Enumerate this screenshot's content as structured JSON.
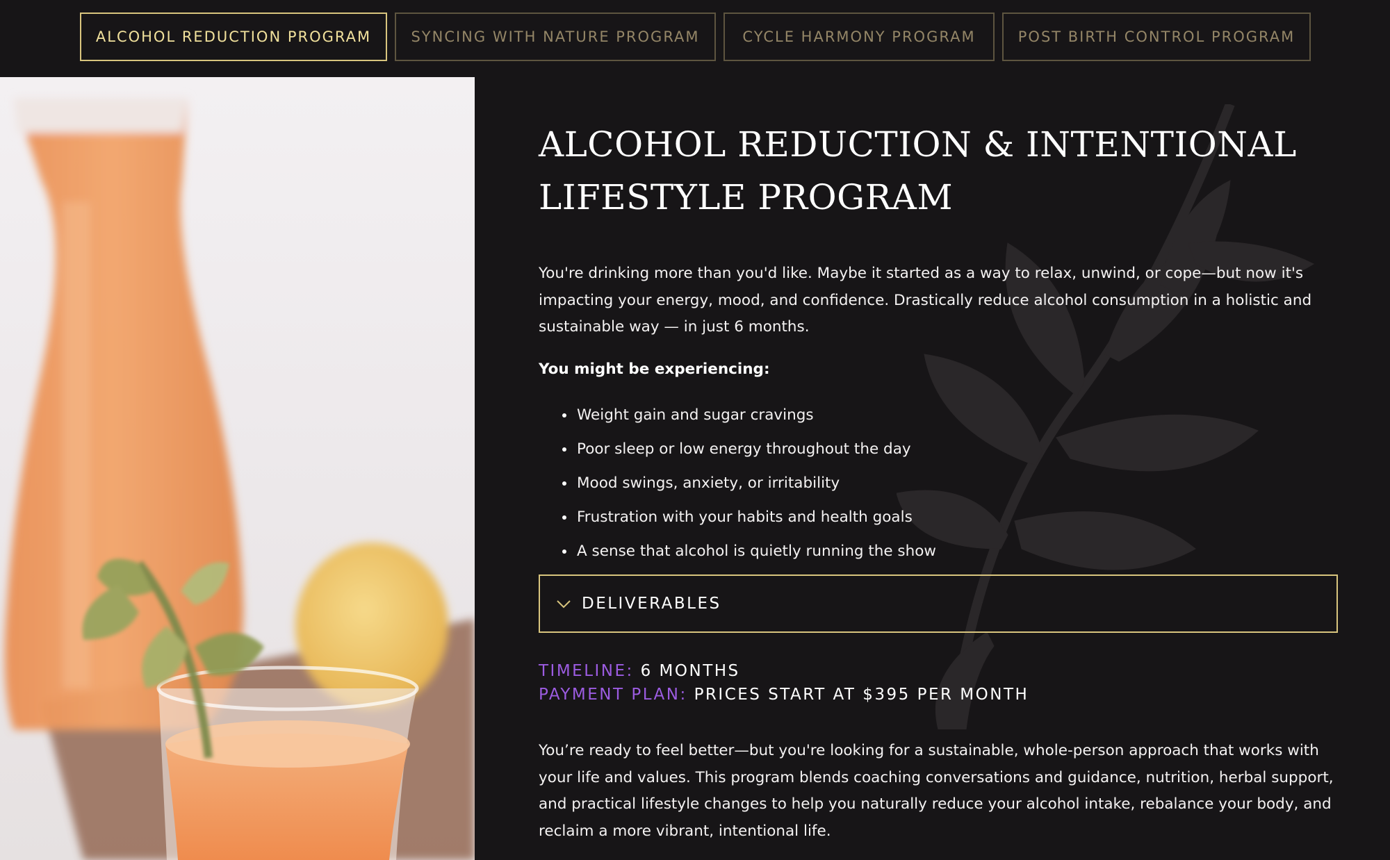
{
  "tabs": [
    {
      "label": "ALCOHOL REDUCTION PROGRAM",
      "active": true
    },
    {
      "label": "SYNCING WITH NATURE PROGRAM",
      "active": false
    },
    {
      "label": "CYCLE HARMONY PROGRAM",
      "active": false
    },
    {
      "label": "POST BIRTH CONTROL PROGRAM",
      "active": false
    }
  ],
  "program": {
    "title_line1": "ALCOHOL REDUCTION & INTENTIONAL",
    "title_line2": "LIFESTYLE PROGRAM",
    "intro": "You're drinking more than you'd like. Maybe it started as a way to relax, unwind, or cope—but now it's impacting your energy, mood, and confidence. Drastically reduce alcohol consumption in a holistic and sustainable way — in just 6 months.",
    "experiencing_heading": "You might be experiencing:",
    "symptoms": [
      "Weight gain and sugar cravings",
      "Poor sleep or low energy throughout the day",
      "Mood swings, anxiety, or irritability",
      "Frustration with your habits and health goals",
      "A sense that alcohol is quietly running the show"
    ],
    "deliverables_label": "DELIVERABLES",
    "timeline_label": "TIMELINE:",
    "timeline_value": "6 MONTHS",
    "payment_label": "PAYMENT PLAN:",
    "payment_value": "PRICES START AT $395 PER MONTH",
    "closing": "You’re ready to feel better—but you're looking for a sustainable, whole-person approach that works with your life and values. This program blends coaching conversations and guidance, nutrition, herbal support, and practical lifestyle changes to help you naturally reduce your alcohol intake, rebalance your body, and reclaim a more vibrant, intentional life."
  },
  "icons": {
    "accordion": "chevron-down-icon",
    "background": "leaf-branch-icon"
  },
  "colors": {
    "background": "#171517",
    "accent_gold": "#d9c57e",
    "active_tab_text": "#f1e19c",
    "label_purple": "#9c5ce1"
  }
}
